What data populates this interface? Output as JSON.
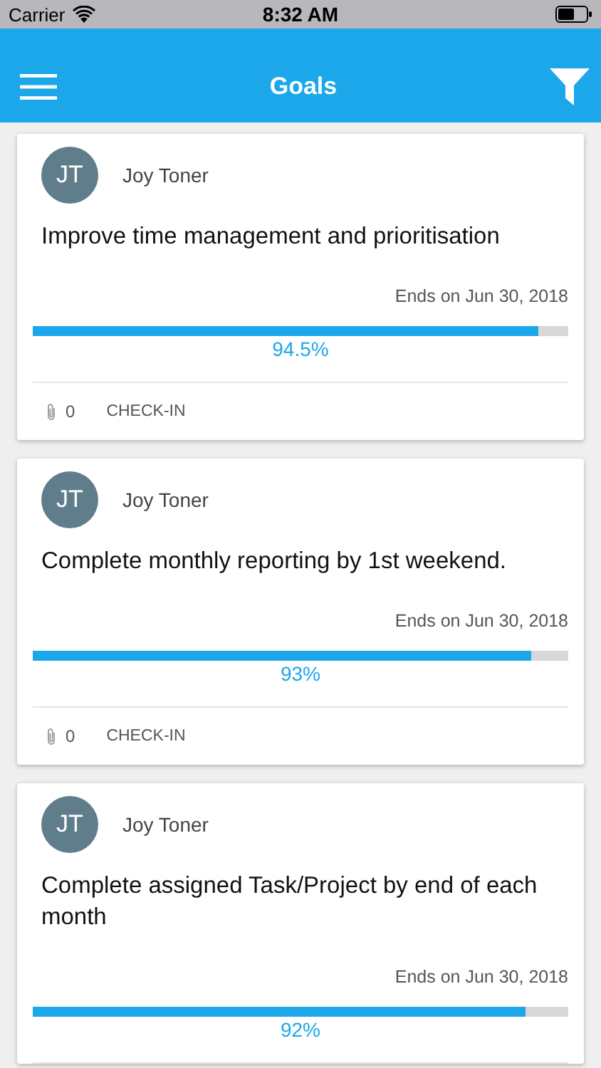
{
  "status_bar": {
    "carrier": "Carrier",
    "time": "8:32 AM"
  },
  "header": {
    "title": "Goals"
  },
  "goals": [
    {
      "initials": "JT",
      "owner": "Joy Toner",
      "title": "Improve time management and prioritisation",
      "ends": "Ends on Jun 30, 2018",
      "level": 0.945,
      "percent": "94.5%",
      "footer": {
        "attachments": "0",
        "action": "CHECK-IN"
      }
    },
    {
      "initials": "JT",
      "owner": "Joy Toner",
      "title": "Complete monthly reporting by 1st weekend.",
      "ends": "Ends on Jun 30, 2018",
      "level": 0.93,
      "percent": "93%",
      "footer": {
        "attachments": "0",
        "action": "CHECK-IN"
      }
    },
    {
      "initials": "JT",
      "owner": "Joy Toner",
      "title": "Complete assigned Task/Project by end of each month",
      "ends": "Ends on Jun 30, 2018",
      "level": 0.92,
      "percent": "92%"
    }
  ]
}
